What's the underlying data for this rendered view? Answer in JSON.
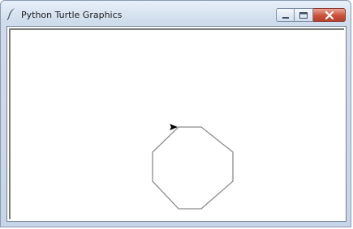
{
  "window": {
    "title": "Python Turtle Graphics",
    "icon": "feather-icon",
    "controls": {
      "minimize_icon": "minimize-icon",
      "maximize_icon": "maximize-icon",
      "close_icon": "close-icon"
    }
  },
  "canvas": {
    "background": "#ffffff",
    "drawing": {
      "shape": "octagon",
      "stroke_color": "#8c8c8c",
      "turtle_icon": "turtle-arrow-icon",
      "turtle_color": "#000000",
      "turtle_heading": "east"
    }
  }
}
